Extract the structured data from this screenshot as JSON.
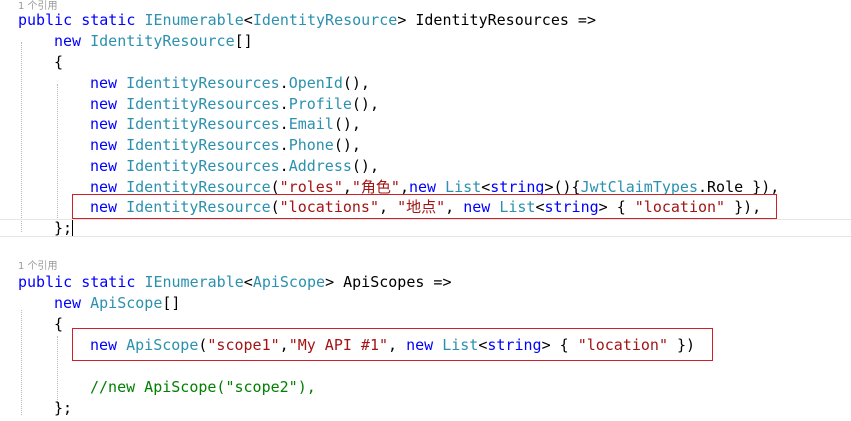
{
  "block1": {
    "refs": "1 个引用",
    "sig": {
      "public": "public",
      "static": "static",
      "ienum": "IEnumerable",
      "lt": "<",
      "type": "IdentityResource",
      "gt": ">",
      "name": " IdentityResources =>"
    },
    "new_line": {
      "new": "new",
      "type": "IdentityResource",
      "tail": "[]"
    },
    "open_brace": "{",
    "items": [
      {
        "new": "new",
        "type": "IdentityResources",
        "dot": ".",
        "member": "OpenId",
        "tail": "(),"
      },
      {
        "new": "new",
        "type": "IdentityResources",
        "dot": ".",
        "member": "Profile",
        "tail": "(),"
      },
      {
        "new": "new",
        "type": "IdentityResources",
        "dot": ".",
        "member": "Email",
        "tail": "(),"
      },
      {
        "new": "new",
        "type": "IdentityResources",
        "dot": ".",
        "member": "Phone",
        "tail": "(),"
      },
      {
        "new": "new",
        "type": "IdentityResources",
        "dot": ".",
        "member": "Address",
        "tail": "(),"
      }
    ],
    "roles": {
      "new": "new",
      "type": "IdentityResource",
      "p1": "(",
      "s1": "\"roles\"",
      "c1": ",",
      "s2": "\"角色\"",
      "c2": ",",
      "new2": "new",
      "list": "List",
      "lt": "<",
      "string": "string",
      "gt": ">",
      "p2": "(){",
      "jwt": "JwtClaimTypes",
      "tail": ".Role }),"
    },
    "locations": {
      "new": "new",
      "type": "IdentityResource",
      "p1": "(",
      "s1": "\"locations\"",
      "c1": ", ",
      "s2": "\"地点\"",
      "c2": ", ",
      "new2": "new",
      "list": "List",
      "lt": "<",
      "string": "string",
      "gt": ">",
      "p2": " { ",
      "s3": "\"location\"",
      "tail": " }),"
    },
    "close": "};"
  },
  "block2": {
    "refs": "1 个引用",
    "sig": {
      "public": "public",
      "static": "static",
      "ienum": "IEnumerable",
      "lt": "<",
      "type": "ApiScope",
      "gt": ">",
      "name": " ApiScopes =>"
    },
    "new_line": {
      "new": "new",
      "type": "ApiScope",
      "tail": "[]"
    },
    "open_brace": "{",
    "scope1": {
      "new": "new",
      "type": "ApiScope",
      "p1": "(",
      "s1": "\"scope1\"",
      "c1": ",",
      "s2": "\"My API #1\"",
      "c2": ", ",
      "new2": "new",
      "list": "List",
      "lt": "<",
      "string": "string",
      "gt": ">",
      "p2": " { ",
      "s3": "\"location\"",
      "tail": " })"
    },
    "comment": "//new ApiScope(\"scope2\"),",
    "close": "};"
  },
  "colors": {
    "keyword": "#0000ff",
    "type": "#2b91af",
    "string": "#a31515",
    "comment": "#008000",
    "highlight_border": "#d0202a"
  }
}
